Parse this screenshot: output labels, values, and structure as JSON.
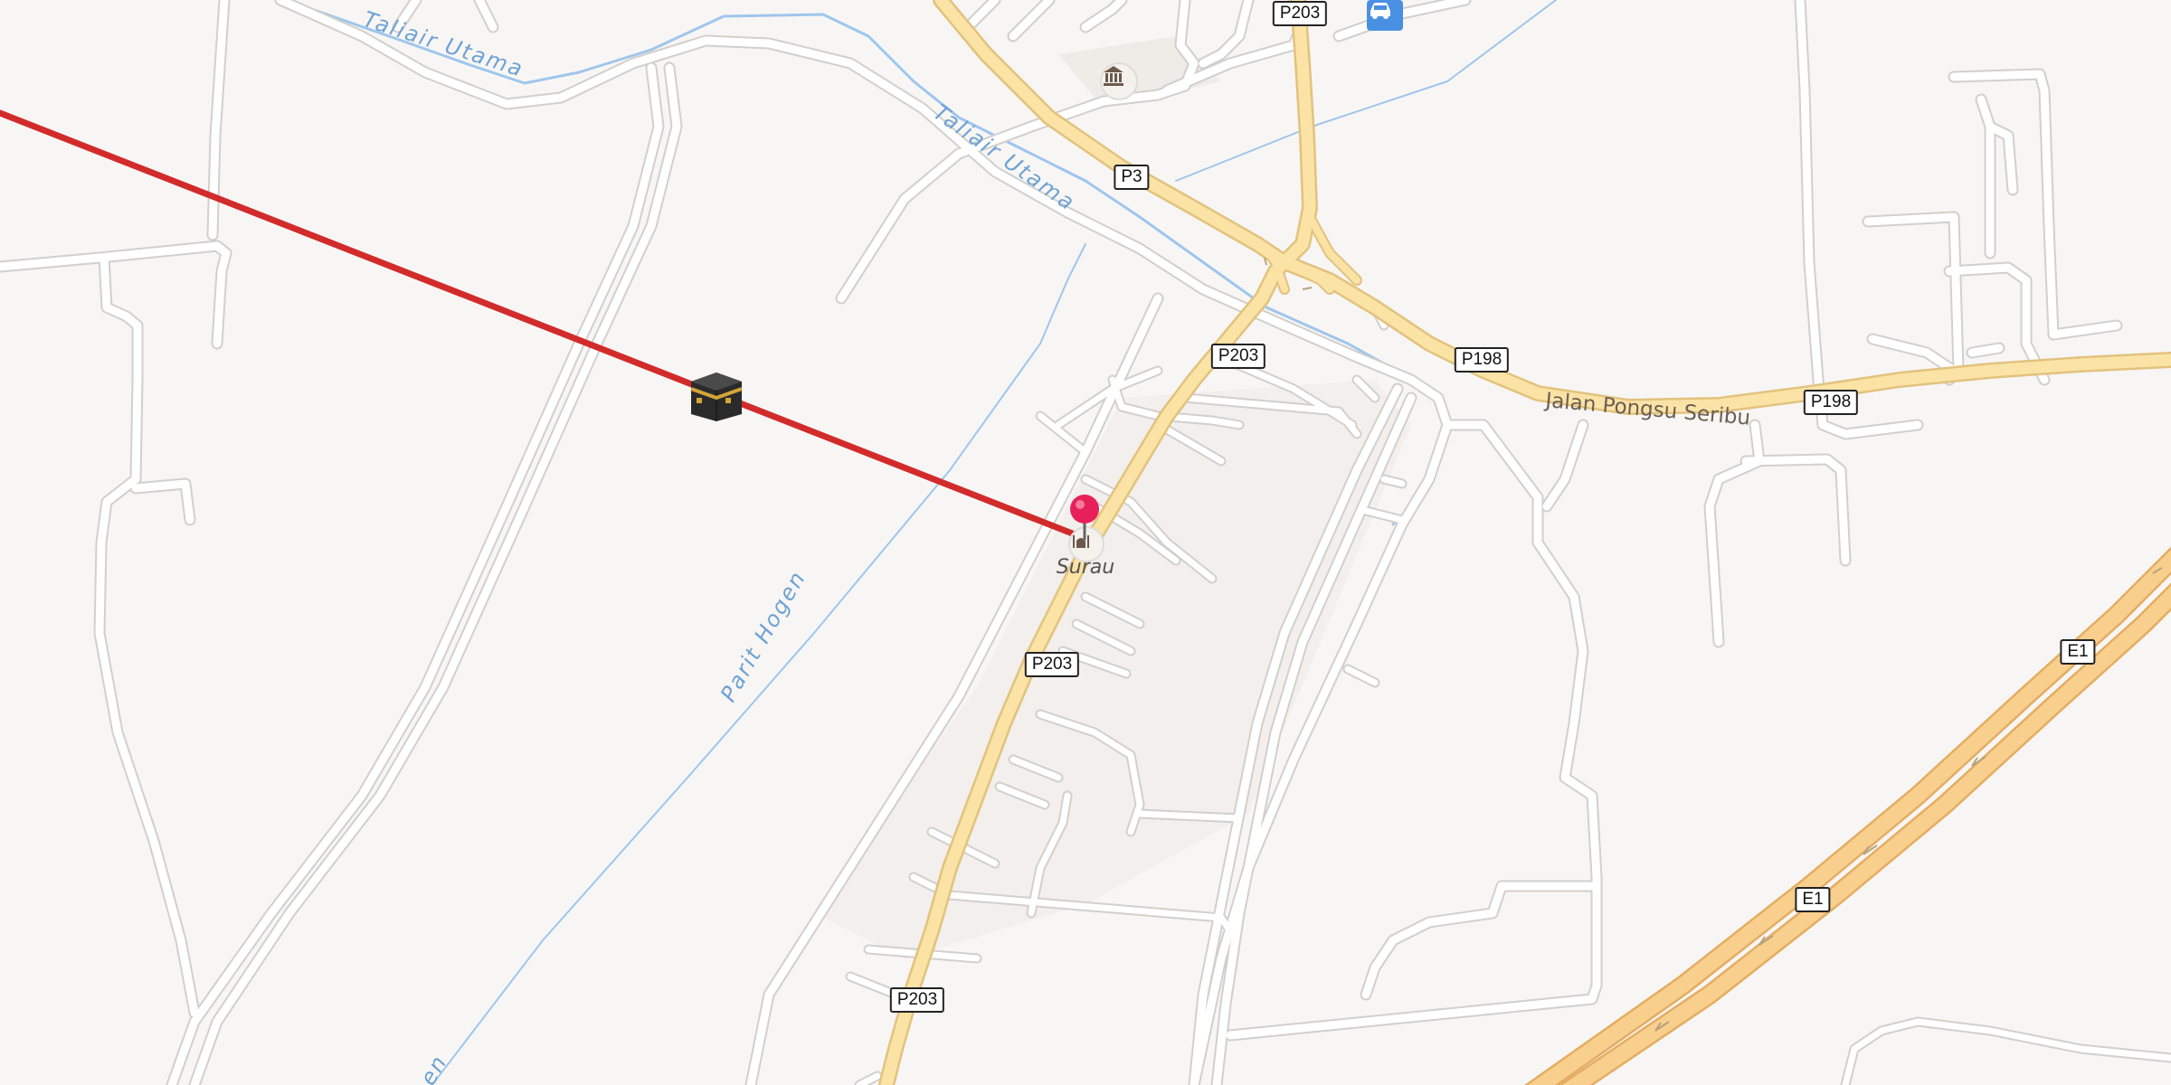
{
  "map": {
    "route_color": "#d22b2b",
    "road_labels": {
      "jalan_pongsu_seribu": "Jalan Pongsu Seribu"
    },
    "water_labels": {
      "taliair_utama_1": "Taliair Utama",
      "taliair_utama_2": "Taliair Utama",
      "parit_hogen": "Parit Hogen",
      "parit_hogen_edge": "en"
    },
    "shields": {
      "p203_top": "P203",
      "p3": "P3",
      "p203_mid": "P203",
      "p198_a": "P198",
      "p198_b": "P198",
      "p203_lower": "P203",
      "p203_bottom": "P203",
      "e1_a": "E1",
      "e1_b": "E1"
    },
    "poi": {
      "surau_label": "Surau",
      "surau_icon": "mosque-icon",
      "museum_icon": "museum-icon",
      "parking_icon": "car-icon",
      "kaaba_icon": "kaaba-icon",
      "pin_icon": "pin-icon"
    }
  }
}
